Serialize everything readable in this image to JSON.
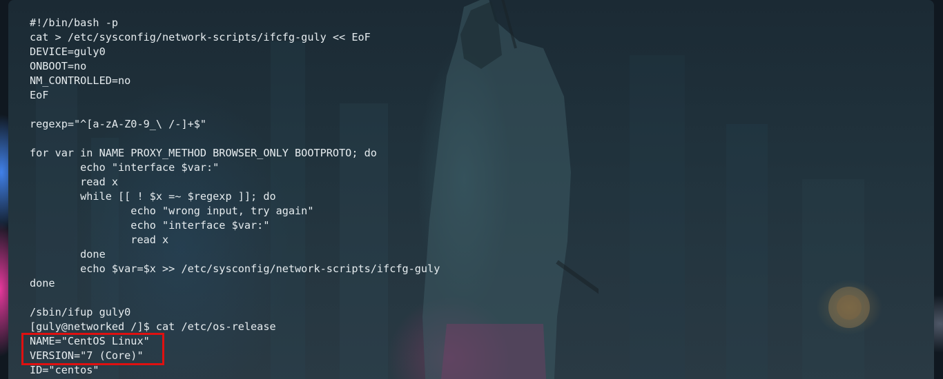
{
  "terminal": {
    "lines": [
      "#!/bin/bash -p",
      "cat > /etc/sysconfig/network-scripts/ifcfg-guly << EoF",
      "DEVICE=guly0",
      "ONBOOT=no",
      "NM_CONTROLLED=no",
      "EoF",
      "",
      "regexp=\"^[a-zA-Z0-9_\\ /-]+$\"",
      "",
      "for var in NAME PROXY_METHOD BROWSER_ONLY BOOTPROTO; do",
      "        echo \"interface $var:\"",
      "        read x",
      "        while [[ ! $x =~ $regexp ]]; do",
      "                echo \"wrong input, try again\"",
      "                echo \"interface $var:\"",
      "                read x",
      "        done",
      "        echo $var=$x >> /etc/sysconfig/network-scripts/ifcfg-guly",
      "done",
      "",
      "/sbin/ifup guly0",
      "[guly@networked /]$ cat /etc/os-release",
      "NAME=\"CentOS Linux\"",
      "VERSION=\"7 (Core)\"",
      "ID=\"centos\""
    ]
  },
  "colors": {
    "text": "#e6ecef",
    "highlight": "#e01010"
  }
}
